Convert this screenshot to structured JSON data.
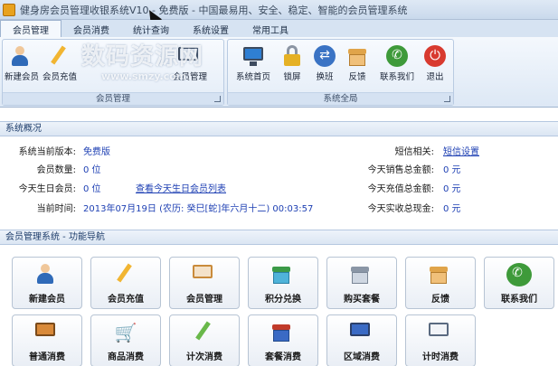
{
  "window": {
    "title": "健身房会员管理收银系统V10 - 免费版 - 中国最易用、安全、稳定、智能的会员管理系统"
  },
  "tabs": [
    {
      "label": "会员管理",
      "active": true
    },
    {
      "label": "会员消费"
    },
    {
      "label": "统计查询"
    },
    {
      "label": "系统设置"
    },
    {
      "label": "常用工具"
    }
  ],
  "watermark": {
    "main": "数码资源网",
    "sub": "www.smzy.com"
  },
  "ribbon": {
    "group1": {
      "label": "会员管理",
      "buttons": [
        {
          "label": "新建会员",
          "icon": "add-member-icon"
        },
        {
          "label": "会员充值",
          "icon": "recharge-icon"
        },
        {
          "label": "会员管理",
          "icon": "member-card-icon"
        }
      ]
    },
    "group2": {
      "label": "系统全局",
      "buttons": [
        {
          "label": "系统首页",
          "icon": "monitor-icon"
        },
        {
          "label": "锁屏",
          "icon": "lock-icon"
        },
        {
          "label": "换班",
          "icon": "swap-icon"
        },
        {
          "label": "反馈",
          "icon": "gift-box-icon"
        },
        {
          "label": "联系我们",
          "icon": "phone-icon"
        },
        {
          "label": "退出",
          "icon": "power-icon"
        }
      ]
    }
  },
  "overview": {
    "title": "系统概况",
    "version_label": "系统当前版本:",
    "version_value": "免费版",
    "sms_label": "短信相关:",
    "sms_link": "短信设置",
    "members_label": "会员数量:",
    "members_value": "0 位",
    "sales_label": "今天销售总金额:",
    "sales_value": "0 元",
    "birthday_label": "今天生日会员:",
    "birthday_value": "0 位",
    "birthday_link": "查看今天生日会员列表",
    "recharge_label": "今天充值总金额:",
    "recharge_value": "0 元",
    "time_label": "当前时间:",
    "time_value": "2013年07月19日 (农历: 癸巳[蛇]年六月十二)  00:03:57",
    "cash_label": "今天实收总现金:",
    "cash_value": "0 元"
  },
  "nav": {
    "title": "会员管理系统 - 功能导航",
    "row1": [
      {
        "label": "新建会员",
        "icon": "add-member-icon"
      },
      {
        "label": "会员充值",
        "icon": "recharge-icon"
      },
      {
        "label": "会员管理",
        "icon": "member-card-icon"
      },
      {
        "label": "积分兑换",
        "icon": "gift-icon"
      },
      {
        "label": "购买套餐",
        "icon": "basket-icon"
      },
      {
        "label": "反馈",
        "icon": "gift-box-icon"
      },
      {
        "label": "联系我们",
        "icon": "phone-icon"
      }
    ],
    "row2": [
      {
        "label": "普通消费",
        "icon": "abacus-icon"
      },
      {
        "label": "商品消费",
        "icon": "cart-icon"
      },
      {
        "label": "计次消费",
        "icon": "tickets-icon"
      },
      {
        "label": "套餐消费",
        "icon": "package-icon"
      },
      {
        "label": "区域消费",
        "icon": "grid-icon"
      },
      {
        "label": "计时消费",
        "icon": "calendar-clock-icon"
      }
    ]
  },
  "colors": {
    "accent": "#1d3fb3",
    "ribbon": "#dde8f5",
    "header": "#1e3d6b"
  }
}
